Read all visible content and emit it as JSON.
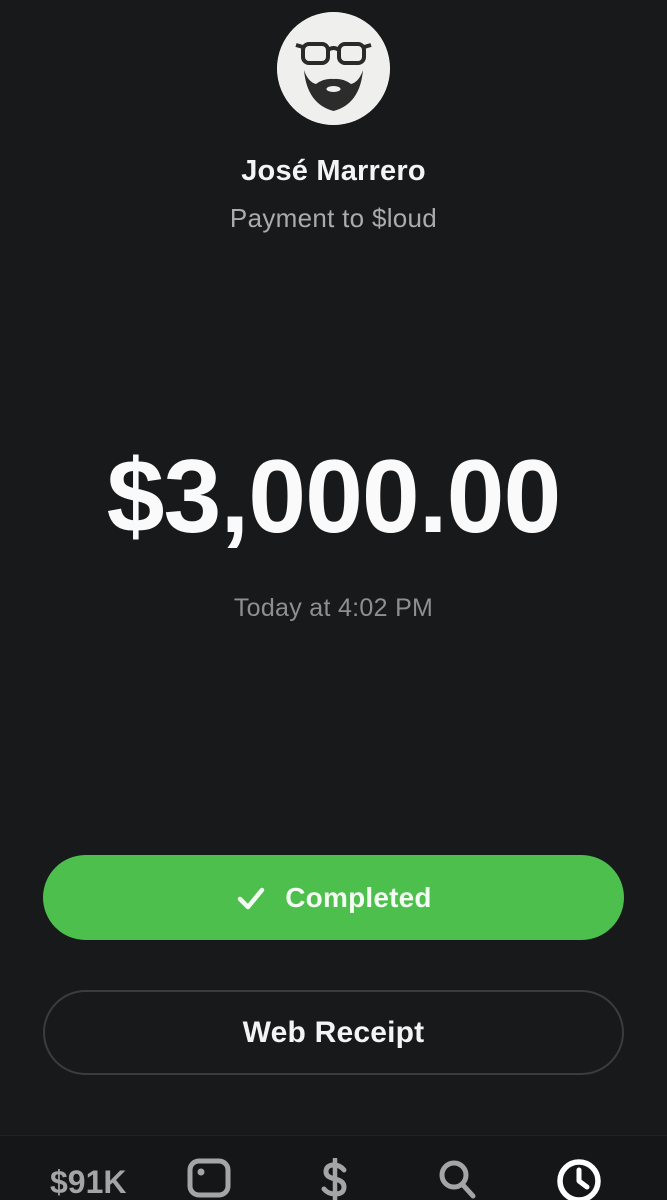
{
  "recipient": {
    "name": "José Marrero",
    "subtitle": "Payment to $loud"
  },
  "payment": {
    "amount": "$3,000.00",
    "timestamp": "Today at 4:02 PM"
  },
  "status_button": {
    "label": "Completed",
    "icon": "checkmark-icon",
    "color": "#4cbf4d"
  },
  "receipt_button": {
    "label": "Web Receipt"
  },
  "tab_bar": {
    "balance": "$91K",
    "icons": [
      "card-icon",
      "dollar-icon",
      "search-icon",
      "clock-icon"
    ],
    "active": "clock-icon"
  }
}
